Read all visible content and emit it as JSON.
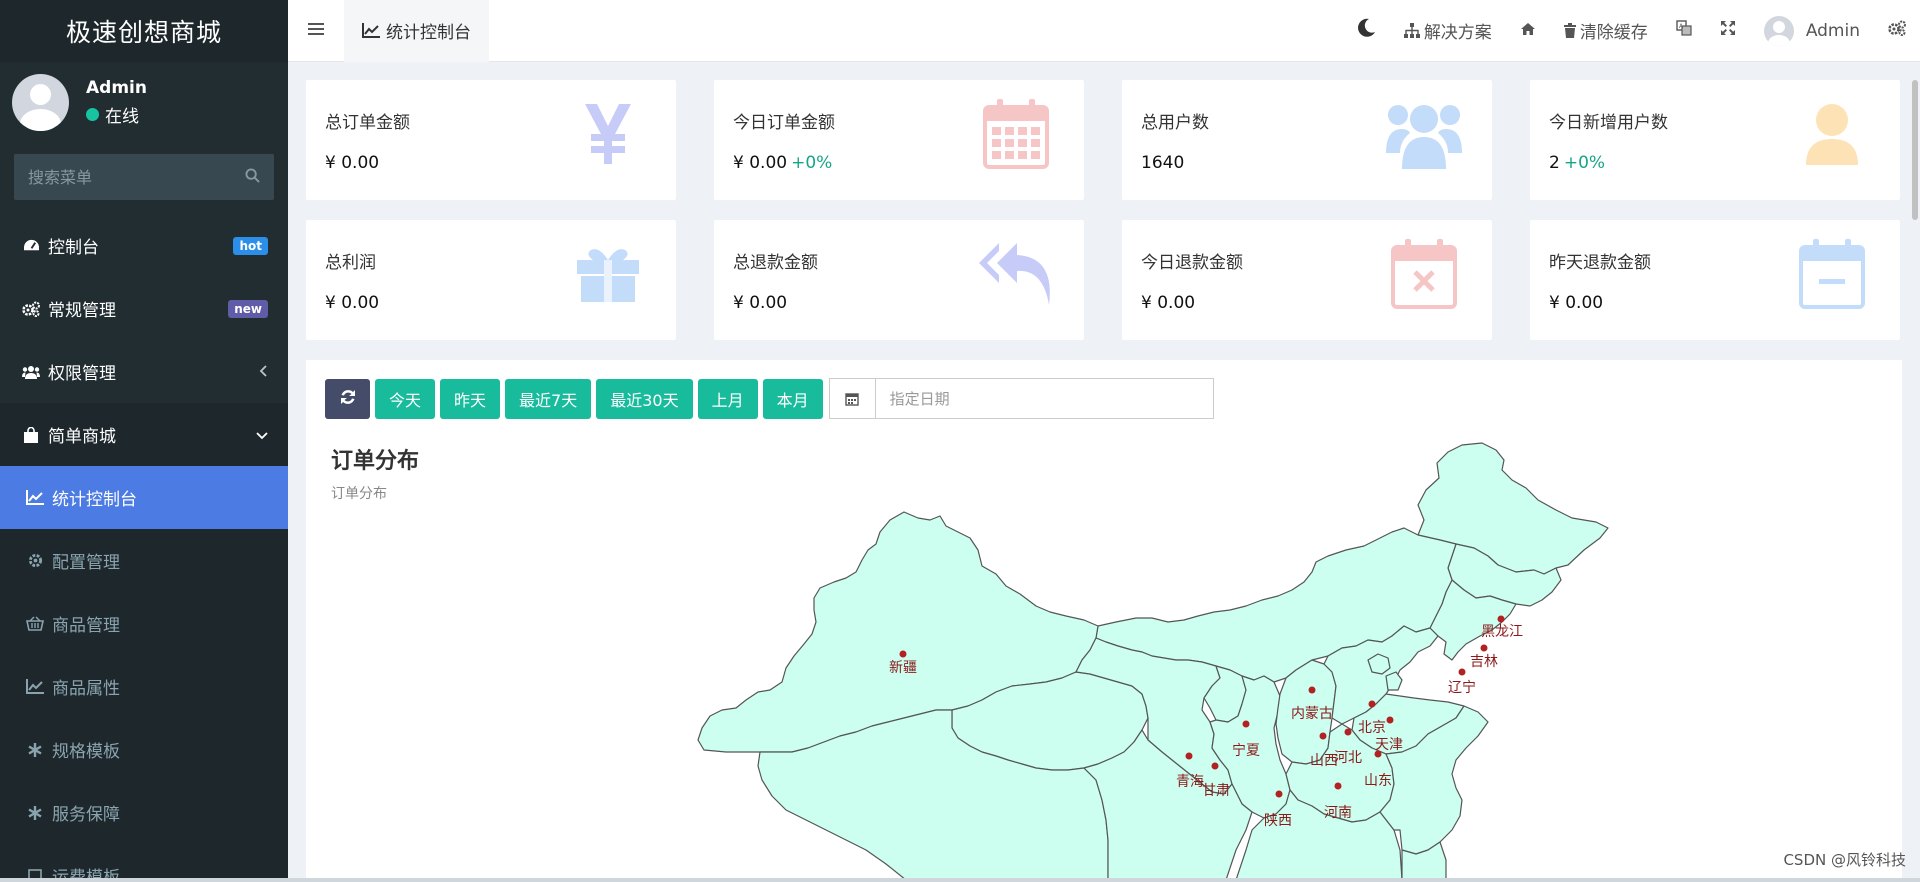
{
  "brand": "极速创想商城",
  "user": {
    "name": "Admin",
    "status": "在线"
  },
  "search": {
    "placeholder": "搜索菜单"
  },
  "menu": {
    "items": [
      {
        "label": "控制台",
        "badge": "hot"
      },
      {
        "label": "常规管理",
        "badge": "new"
      },
      {
        "label": "权限管理"
      },
      {
        "label": "简单商城"
      }
    ],
    "sub_items": [
      {
        "label": "统计控制台"
      },
      {
        "label": "配置管理"
      },
      {
        "label": "商品管理"
      },
      {
        "label": "商品属性"
      },
      {
        "label": "规格模板"
      },
      {
        "label": "服务保障"
      },
      {
        "label": "运费模板"
      }
    ]
  },
  "navbar": {
    "tab": "统计控制台",
    "solutions": "解决方案",
    "clear_cache": "清除缓存",
    "admin": "Admin"
  },
  "stats": [
    {
      "title": "总订单金额",
      "value": "¥ 0.00",
      "change": "",
      "icon": "yen-icon",
      "color": "#c7cbf7"
    },
    {
      "title": "今日订单金额",
      "value": "¥ 0.00",
      "change": "+0%",
      "icon": "calendar-icon",
      "color": "#f6c6c6"
    },
    {
      "title": "总用户数",
      "value": "1640",
      "change": "",
      "icon": "users-icon",
      "color": "#c2dcf9"
    },
    {
      "title": "今日新增用户数",
      "value": "2",
      "change": "+0%",
      "icon": "user-icon",
      "color": "#fde2b6"
    },
    {
      "title": "总利润",
      "value": "¥ 0.00",
      "change": "",
      "icon": "gift-icon",
      "color": "#c2dcf9"
    },
    {
      "title": "总退款金额",
      "value": "¥ 0.00",
      "change": "",
      "icon": "reply-all-icon",
      "color": "#c7cbf7"
    },
    {
      "title": "今日退款金额",
      "value": "¥ 0.00",
      "change": "",
      "icon": "calendar-times-icon",
      "color": "#f6c6c6"
    },
    {
      "title": "昨天退款金额",
      "value": "¥ 0.00",
      "change": "",
      "icon": "calendar-minus-icon",
      "color": "#c2dcf9"
    }
  ],
  "filters": {
    "buttons": [
      "今天",
      "昨天",
      "最近7天",
      "最近30天",
      "上月",
      "本月"
    ],
    "date_placeholder": "指定日期"
  },
  "chart": {
    "title": "订单分布",
    "subtitle": "订单分布"
  },
  "map": {
    "fill_color": "#ccfff0",
    "stroke_color": "#555555",
    "point_color": "#b22222",
    "provinces": [
      "新疆",
      "黑龙江",
      "吉林",
      "辽宁",
      "内蒙古",
      "北京",
      "天津",
      "河北",
      "山西",
      "宁夏",
      "青海",
      "甘肃",
      "山东",
      "河南",
      "陕西"
    ]
  },
  "watermark": "CSDN @风铃科技",
  "colors": {
    "accent": "#18bc9c",
    "sidebar": "#222d32",
    "active": "#4c7be3"
  }
}
